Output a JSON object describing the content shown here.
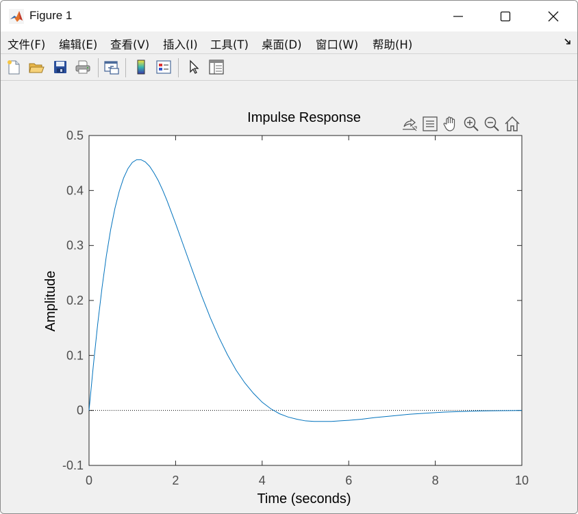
{
  "window": {
    "title": "Figure 1",
    "icon": "matlab-icon",
    "controls": [
      "minimize-icon",
      "maximize-icon",
      "close-icon"
    ]
  },
  "menu": {
    "items": [
      {
        "label": "文件(F)"
      },
      {
        "label": "编辑(E)"
      },
      {
        "label": "查看(V)"
      },
      {
        "label": "插入(I)"
      },
      {
        "label": "工具(T)"
      },
      {
        "label": "桌面(D)"
      },
      {
        "label": "窗口(W)"
      },
      {
        "label": "帮助(H)"
      }
    ]
  },
  "toolbar": {
    "buttons": [
      {
        "icon": "new-figure-icon"
      },
      {
        "icon": "open-file-icon"
      },
      {
        "icon": "save-icon"
      },
      {
        "icon": "print-icon"
      },
      {
        "icon": "link-plot-icon"
      },
      {
        "icon": "colorbar-icon"
      },
      {
        "icon": "legend-icon"
      },
      {
        "icon": "pointer-icon"
      },
      {
        "icon": "property-inspector-icon"
      }
    ]
  },
  "axes_toolbar": {
    "buttons": [
      "data-tips-icon",
      "brush-icon",
      "pan-hand-icon",
      "zoom-in-icon",
      "zoom-out-icon",
      "home-icon"
    ]
  },
  "chart_data": {
    "type": "line",
    "title": "Impulse Response",
    "xlabel": "Time (seconds)",
    "ylabel": "Amplitude",
    "xlim": [
      0,
      10
    ],
    "ylim": [
      -0.1,
      0.5
    ],
    "xticks": [
      "0",
      "2",
      "4",
      "6",
      "8",
      "10"
    ],
    "yticks": [
      "-0.1",
      "0",
      "0.1",
      "0.2",
      "0.3",
      "0.4",
      "0.5"
    ],
    "grid": false,
    "series": [
      {
        "color": "#0072BD",
        "x": [
          0,
          0.1,
          0.2,
          0.3,
          0.4,
          0.5,
          0.6,
          0.7,
          0.8,
          0.9,
          1.0,
          1.1,
          1.2,
          1.3,
          1.4,
          1.5,
          1.6,
          1.7,
          1.8,
          2.0,
          2.2,
          2.4,
          2.6,
          2.8,
          3.0,
          3.2,
          3.4,
          3.6,
          3.8,
          4.0,
          4.2,
          4.4,
          4.6,
          4.8,
          5.0,
          5.2,
          5.4,
          5.6,
          5.8,
          6.0,
          6.3,
          6.6,
          7.0,
          7.4,
          7.8,
          8.2,
          8.6,
          9.0,
          9.4,
          9.8,
          10.0
        ],
        "y": [
          0,
          0.082,
          0.157,
          0.223,
          0.281,
          0.329,
          0.368,
          0.399,
          0.423,
          0.44,
          0.451,
          0.456,
          0.456,
          0.452,
          0.444,
          0.432,
          0.418,
          0.401,
          0.382,
          0.34,
          0.296,
          0.252,
          0.209,
          0.169,
          0.133,
          0.101,
          0.073,
          0.05,
          0.031,
          0.015,
          0.003,
          -0.006,
          -0.012,
          -0.016,
          -0.019,
          -0.02,
          -0.02,
          -0.02,
          -0.019,
          -0.018,
          -0.016,
          -0.013,
          -0.01,
          -0.007,
          -0.005,
          -0.003,
          -0.002,
          -0.001,
          -0.0005,
          -0.0002,
          0
        ]
      }
    ],
    "reference_line": {
      "y": 0,
      "style": "dotted",
      "color": "#000000"
    }
  }
}
